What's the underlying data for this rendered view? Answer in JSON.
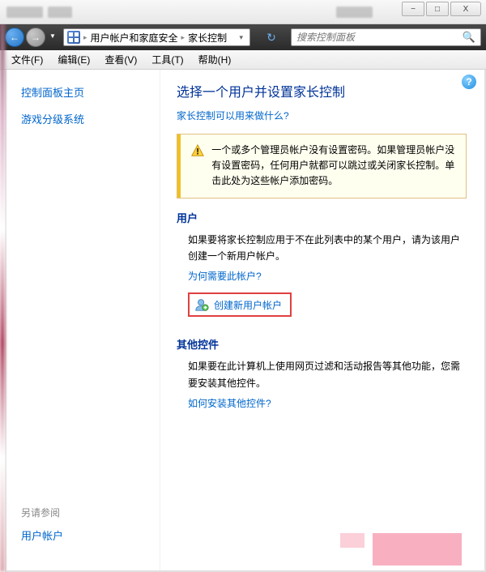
{
  "window": {
    "minimize": "−",
    "maximize": "□",
    "close": "X"
  },
  "nav": {
    "back": "←",
    "forward": "→",
    "dropdown": "▼",
    "refresh": "↻"
  },
  "breadcrumb": {
    "item1": "用户帐户和家庭安全",
    "item2": "家长控制",
    "sep": "▸"
  },
  "search": {
    "placeholder": "搜索控制面板",
    "icon": "🔍"
  },
  "menu": {
    "file": "文件(F)",
    "edit": "编辑(E)",
    "view": "查看(V)",
    "tools": "工具(T)",
    "help": "帮助(H)"
  },
  "sidebar": {
    "home": "控制面板主页",
    "rating": "游戏分级系统",
    "see_also_label": "另请参阅",
    "user_accounts": "用户帐户"
  },
  "main": {
    "help": "?",
    "title": "选择一个用户并设置家长控制",
    "what_link": "家长控制可以用来做什么?",
    "warning": "一个或多个管理员帐户没有设置密码。如果管理员帐户没有设置密码，任何用户就都可以跳过或关闭家长控制。单击此处为这些帐户添加密码。",
    "users_label": "用户",
    "users_text": "如果要将家长控制应用于不在此列表中的某个用户，请为该用户创建一个新用户帐户。",
    "why_link": "为何需要此帐户?",
    "create_link": "创建新用户帐户",
    "other_label": "其他控件",
    "other_text": "如果要在此计算机上使用网页过滤和活动报告等其他功能，您需要安装其他控件。",
    "how_link": "如何安装其他控件?"
  }
}
